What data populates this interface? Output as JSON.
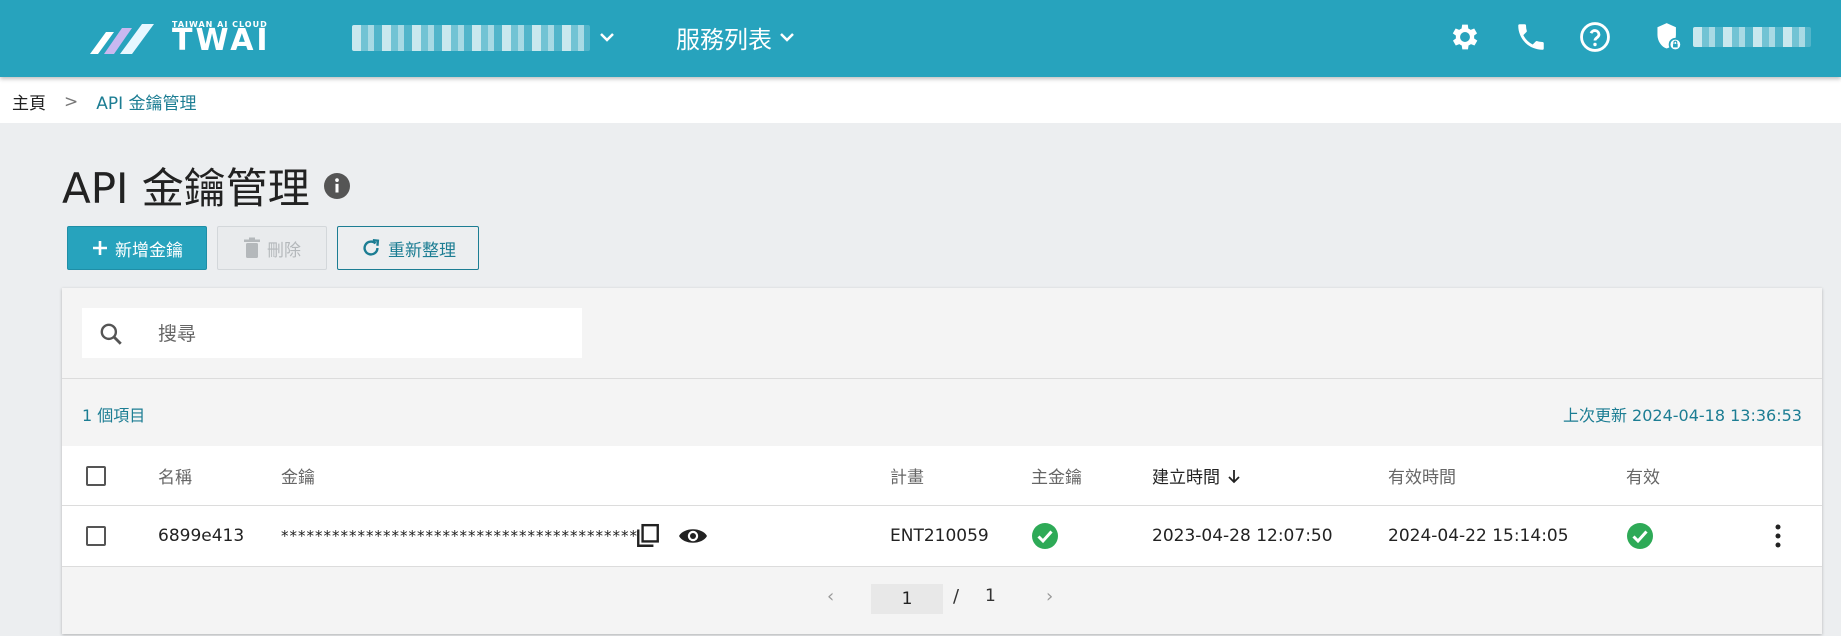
{
  "header": {
    "logo_small": "TAIWAN AI CLOUD",
    "logo_big": "TWAI",
    "services_label": "服務列表",
    "icons": [
      "gear-icon",
      "phone-icon",
      "help-icon",
      "user-shield-icon"
    ]
  },
  "breadcrumb": {
    "home": "主頁",
    "separator": ">",
    "current": "API 金鑰管理"
  },
  "page": {
    "title": "API 金鑰管理"
  },
  "toolbar": {
    "add_label": "新增金鑰",
    "delete_label": "刪除",
    "refresh_label": "重新整理"
  },
  "search": {
    "placeholder": "搜尋"
  },
  "summary": {
    "count": "1 個項目",
    "last_updated": "上次更新 2024-04-18 13:36:53"
  },
  "table": {
    "columns": {
      "name": "名稱",
      "key": "金鑰",
      "plan": "計畫",
      "primary": "主金鑰",
      "created": "建立時間",
      "expires": "有效時間",
      "valid": "有效"
    },
    "rows": [
      {
        "name": "6899e413",
        "key": "******************************************",
        "plan": "ENT210059",
        "primary": true,
        "created": "2023-04-28 12:07:50",
        "expires": "2024-04-22 15:14:05",
        "valid": true
      }
    ]
  },
  "pagination": {
    "current": "1",
    "separator": "/",
    "total": "1"
  },
  "colors": {
    "brand": "#27a3bd",
    "link": "#1c7d93",
    "success": "#2eaa57"
  }
}
